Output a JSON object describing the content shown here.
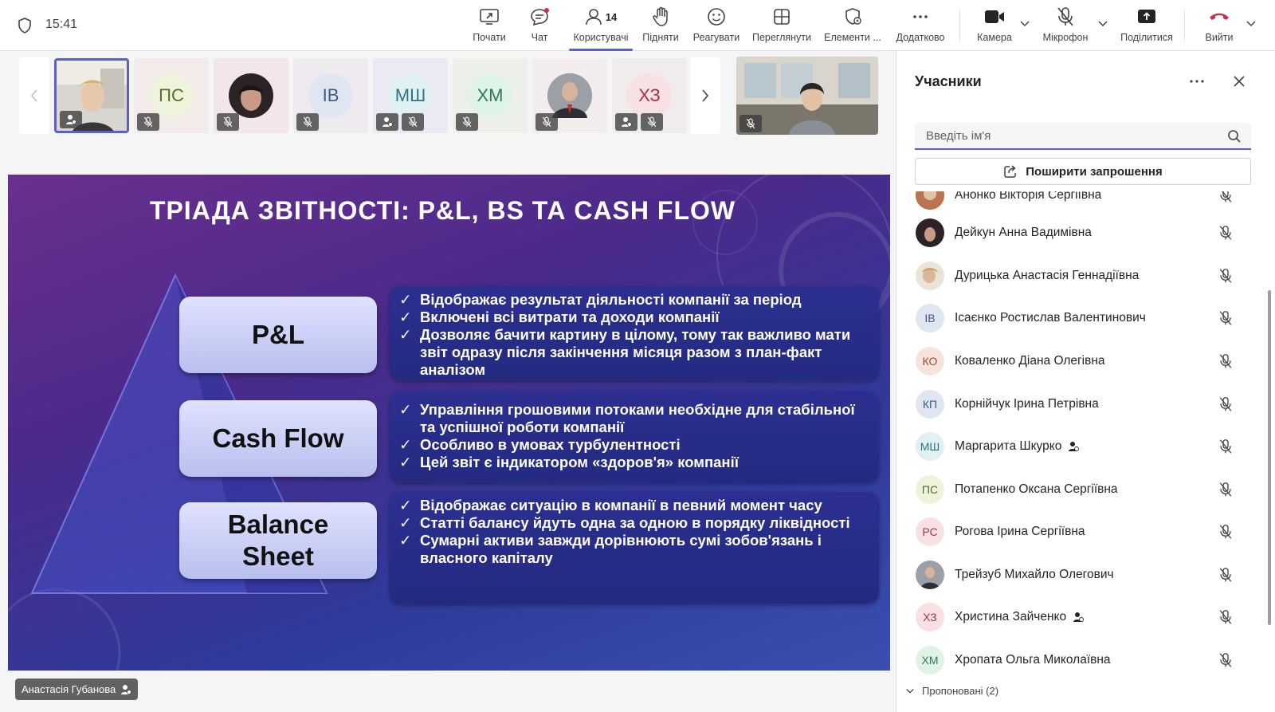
{
  "app": {
    "time": "15:41"
  },
  "toolbar": {
    "items": [
      {
        "label": "Почати",
        "icon": "share-screen-icon"
      },
      {
        "label": "Чат",
        "icon": "chat-icon"
      },
      {
        "label": "Користувачі",
        "icon": "people-icon",
        "count": "14"
      },
      {
        "label": "Підняти",
        "icon": "raise-hand-icon"
      },
      {
        "label": "Реагувати",
        "icon": "smile-icon"
      },
      {
        "label": "Переглянути",
        "icon": "view-grid-icon"
      },
      {
        "label": "Елементи ...",
        "icon": "apps-icon"
      },
      {
        "label": "Додатково",
        "icon": "more-icon"
      },
      {
        "label": "Камера",
        "icon": "camera-icon"
      },
      {
        "label": "Мікрофон",
        "icon": "mic-off-icon"
      },
      {
        "label": "Поділитися",
        "icon": "share-icon"
      },
      {
        "label": "Вийти",
        "icon": "hang-up-icon"
      }
    ]
  },
  "strip": {
    "tiles": [
      {
        "initials": "",
        "kind": "photo"
      },
      {
        "initials": "ПС",
        "kind": "initials"
      },
      {
        "initials": "",
        "kind": "photo"
      },
      {
        "initials": "ІВ",
        "kind": "initials"
      },
      {
        "initials": "МШ",
        "kind": "initials"
      },
      {
        "initials": "ХМ",
        "kind": "initials"
      },
      {
        "initials": "",
        "kind": "photo"
      },
      {
        "initials": "ХЗ",
        "kind": "initials"
      }
    ]
  },
  "slide": {
    "title": "ТРІАДА ЗВІТНОСТІ: P&L, BS ТА CASH FLOW",
    "blocks": [
      {
        "label": "P&L",
        "bullets": [
          "Відображає результат діяльності компанії за період",
          "Включені всі витрати та доходи компанії",
          "Дозволяє бачити картину в цілому, тому так важливо мати звіт одразу після закінчення місяця разом з план-факт аналізом"
        ]
      },
      {
        "label": "Cash Flow",
        "bullets": [
          "Управління грошовими потоками необхідне для стабільної та успішної роботи компанії",
          "Особливо в умовах турбулентності",
          "Цей звіт є індикатором «здоров'я» компанії"
        ]
      },
      {
        "label": "Balance Sheet",
        "bullets": [
          "Відображає ситуацію в компанії в певний момент часу",
          "Статті балансу йдуть одна за одною в порядку ліквідності",
          "Сумарні активи завжди дорівнюють сумі зобов'язань і власного капіталу"
        ]
      }
    ]
  },
  "presenter": {
    "name": "Анастасія Губанова"
  },
  "sidebar": {
    "title": "Учасники",
    "search_placeholder": "Введіть ім'я",
    "share_label": "Поширити запрошення",
    "participants": [
      {
        "name": "Анонко Вікторія Сергіївна",
        "initials": "",
        "photo": true,
        "badge": false
      },
      {
        "name": "Дейкун Анна Вадимівна",
        "initials": "",
        "photo": true,
        "badge": false
      },
      {
        "name": "Дурицька Анастасія Геннадіївна",
        "initials": "",
        "photo": true,
        "badge": false
      },
      {
        "name": "Ісаєнко Ростислав Валентинович",
        "initials": "ІВ",
        "photo": false,
        "badge": false
      },
      {
        "name": "Коваленко Діана Олегівна",
        "initials": "КО",
        "photo": false,
        "badge": false
      },
      {
        "name": "Корнійчук Ірина Петрівна",
        "initials": "КП",
        "photo": false,
        "badge": false
      },
      {
        "name": "Маргарита Шкурко",
        "initials": "МШ",
        "photo": false,
        "badge": true
      },
      {
        "name": "Потапенко Оксана Сергіївна",
        "initials": "ПС",
        "photo": false,
        "badge": false
      },
      {
        "name": "Рогова Ірина Сергіївна",
        "initials": "РС",
        "photo": false,
        "badge": false
      },
      {
        "name": "Трейзуб Михайло Олегович",
        "initials": "",
        "photo": true,
        "badge": false
      },
      {
        "name": "Христина Зайченко",
        "initials": "ХЗ",
        "photo": false,
        "badge": true
      },
      {
        "name": "Хропата Ольга Миколаївна",
        "initials": "ХМ",
        "photo": false,
        "badge": false
      }
    ],
    "suggested": "Пропоновані (2)"
  },
  "colors": {
    "accent": "#5b5fc7",
    "leave": "#c4314b"
  }
}
